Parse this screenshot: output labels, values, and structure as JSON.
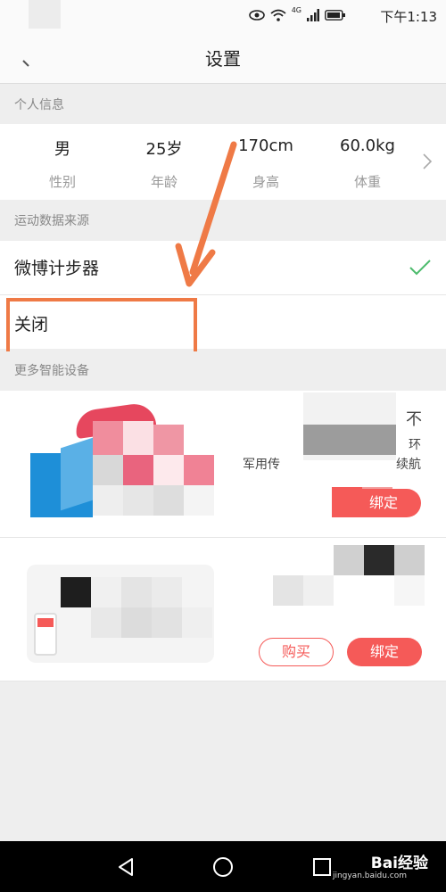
{
  "status_bar": {
    "time": "下午1:13",
    "network": "4G"
  },
  "header": {
    "title": "设置",
    "back_icon": "back-arrow-icon"
  },
  "personal_info": {
    "section_title": "个人信息",
    "items": [
      {
        "value": "男",
        "label": "性别"
      },
      {
        "value": "25岁",
        "label": "年龄"
      },
      {
        "value": "170cm",
        "label": "身高"
      },
      {
        "value": "60.0kg",
        "label": "体重"
      }
    ]
  },
  "data_source": {
    "section_title": "运动数据来源",
    "options": [
      {
        "label": "微博计步器",
        "selected": true
      },
      {
        "label": "关闭",
        "selected": false
      }
    ]
  },
  "more_devices": {
    "section_title": "更多智能设备",
    "devices": [
      {
        "desc": "军用传",
        "desc_right": "不",
        "desc_right2": "环",
        "desc_right3": "续航",
        "bind_label": "绑定"
      },
      {
        "buy_label": "购买",
        "bind_label": "绑定"
      }
    ]
  },
  "watermark": {
    "brand": "Bai经验",
    "domain": "jingyan.baidu.com"
  },
  "colors": {
    "accent": "#f55a58",
    "check": "#4cbb6c",
    "annotation": "#ef7a46"
  }
}
